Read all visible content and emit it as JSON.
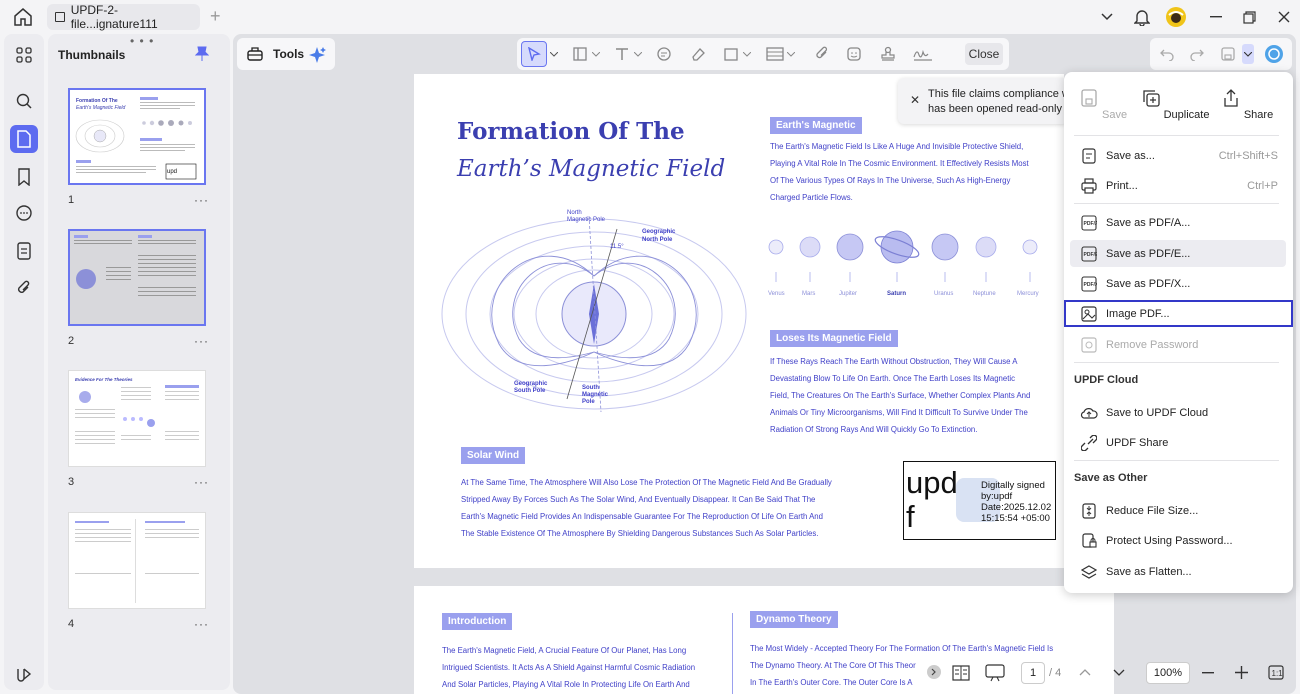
{
  "tab": {
    "title": "UPDF-2-file...ignature111"
  },
  "panel": {
    "title": "Thumbnails",
    "pages": [
      "1",
      "2",
      "3",
      "4"
    ]
  },
  "toolbar": {
    "tools_label": "Tools",
    "close_label": "Close"
  },
  "document": {
    "title_line1": "Formation Of The",
    "title_line2": "Earth’s Magnetic Field",
    "section_earths": "Earth's Magnetic",
    "text_earths": [
      "The Earth's Magnetic Field Is Like A Huge And Invisible Protective Shield,",
      "Playing A Vital Role In The Cosmic Environment. It Effectively Resists Most",
      "Of The Various Types Of Rays In The Universe, Such As High-Energy",
      "Charged Particle Flows."
    ],
    "planets": [
      "Venus",
      "Mars",
      "Jupiter",
      "Saturn",
      "Uranus",
      "Neptune",
      "Mercury"
    ],
    "section_loses": "Loses Its Magnetic Field",
    "text_loses": [
      "If These Rays Reach The Earth Without Obstruction, They Will Cause A",
      "Devastating Blow To Life On Earth. Once The Earth Loses Its Magnetic",
      "Field, The Creatures On The Earth's Surface, Whether Complex Plants And",
      "Animals Or Tiny Microorganisms, Will Find It Difficult To Survive Under The",
      "Radiation Of Strong Rays And Will Quickly Go To Extinction."
    ],
    "diagram_labels": {
      "north_magnetic": "North\nMagnetic Pole",
      "geographic_north": "Geographic\nNorth Pole",
      "angle": "11.5°",
      "geographic_south": "Geographic\nSouth Pole",
      "south_magnetic": "South\nMagnetic\nPole"
    },
    "section_solar": "Solar Wind",
    "text_solar": [
      "At The Same Time, The Atmosphere Will Also Lose The Protection Of The Magnetic Field And Be Gradually",
      "Stripped Away By Forces Such As The Solar Wind, And Eventually Disappear. It Can Be Said That The",
      "Earth's Magnetic Field Provides An Indispensable Guarantee For The Reproduction Of Life On Earth And",
      "The Stable Existence Of The Atmosphere By Shielding Dangerous Substances Such As Solar Particles."
    ],
    "signature": {
      "big": "upd\nf",
      "info": "Digitally signed\nby:updf\nDate:2025.12.02\n15:15:54 +05:00"
    },
    "section_intro": "Introduction",
    "text_intro": [
      "The Earth's Magnetic Field, A Crucial Feature Of Our Planet, Has Long",
      "Intrigued Scientists. It Acts As A Shield Against Harmful Cosmic Radiation",
      "And Solar Particles, Playing A Vital Role In Protecting Life On Earth And"
    ],
    "section_dynamo": "Dynamo Theory",
    "text_dynamo": [
      "The Most Widely - Accepted Theory For The Formation Of The Earth's Magnetic Field Is",
      "The Dynamo Theory. At The Core Of This Theor",
      "In The Earth's Outer Core. The Outer Core Is A"
    ]
  },
  "notice": {
    "text": "This file claims compliance wit\nhas been opened read-only to"
  },
  "footer": {
    "page_current": "1",
    "page_total": "/ 4",
    "zoom": "100%"
  },
  "menu": {
    "top": [
      {
        "label": "Save",
        "disabled": true
      },
      {
        "label": "Duplicate"
      },
      {
        "label": "Share"
      }
    ],
    "save_as": "Save as...",
    "save_as_sc": "Ctrl+Shift+S",
    "print": "Print...",
    "print_sc": "Ctrl+P",
    "pdfa": "Save as PDF/A...",
    "pdfe": "Save as PDF/E...",
    "pdfx": "Save as PDF/X...",
    "image_pdf": "Image PDF...",
    "remove_password": "Remove Password",
    "cloud_section": "UPDF Cloud",
    "save_cloud": "Save to UPDF Cloud",
    "updf_share": "UPDF Share",
    "other_section": "Save as Other",
    "reduce": "Reduce File Size...",
    "protect": "Protect Using Password...",
    "flatten": "Save as Flatten..."
  },
  "colors": {
    "accent": "#5d6bf0",
    "doc_blue": "#3b3fb0",
    "pill": "#9aa0ee",
    "highlight": "#3338c8"
  }
}
